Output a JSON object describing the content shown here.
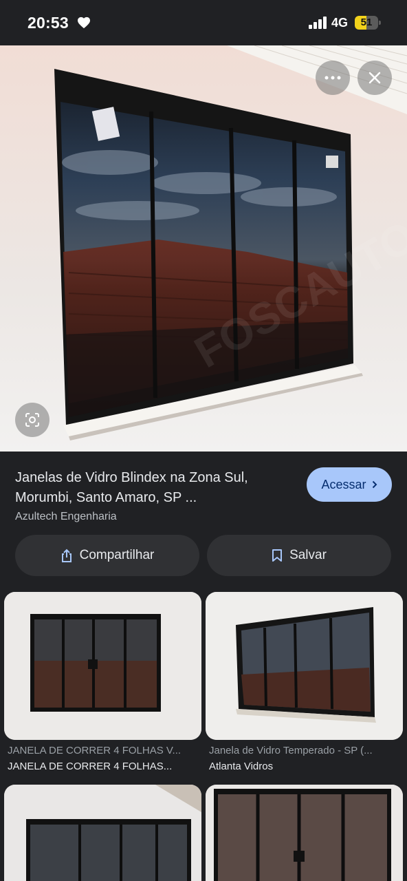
{
  "status_bar": {
    "time": "20:53",
    "network": "4G",
    "battery": "51",
    "battery_level": 0.51,
    "icons": [
      "heart-icon",
      "signal-icon",
      "battery-icon"
    ]
  },
  "hero": {
    "watermark": "FOSCAUTO",
    "more_icon": "more-horizontal-icon",
    "close_icon": "close-icon",
    "lens_icon": "lens-search-icon"
  },
  "result": {
    "title": "Janelas de Vidro Blindex na Zona Sul, Morumbi, Santo Amaro, SP ...",
    "source": "Azultech Engenharia",
    "visit_label": "Acessar",
    "share_label": "Compartilhar",
    "save_label": "Salvar"
  },
  "related": [
    {
      "title": "JANELA DE CORRER 4 FOLHAS V...",
      "source": "JANELA DE CORRER 4 FOLHAS..."
    },
    {
      "title": "Janela de Vidro Temperado - SP (...",
      "source": "Atlanta Vidros"
    },
    {
      "title": "",
      "source": ""
    },
    {
      "title": "",
      "source": ""
    }
  ]
}
